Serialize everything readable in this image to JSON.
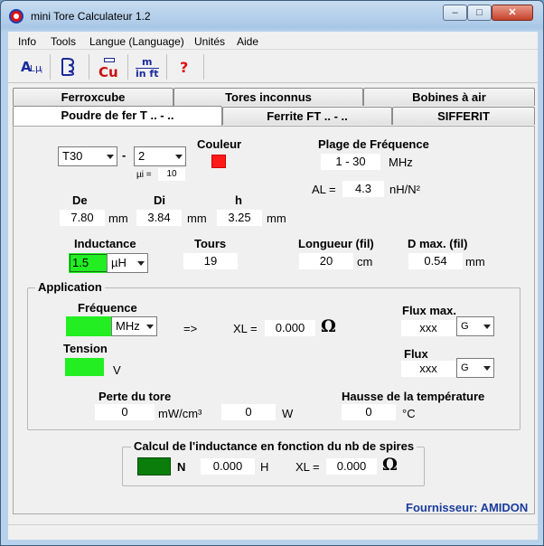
{
  "window": {
    "title": "mini Tore Calculateur 1.2",
    "min": "–",
    "max": "□",
    "close": "✕"
  },
  "menu": [
    "Info",
    "Tools",
    "Langue (Language)",
    "Unités",
    "Aide"
  ],
  "toolbar": [
    {
      "icon": "al-mu-icon",
      "text": "AL μi"
    },
    {
      "icon": "coil-icon",
      "text": "⌇"
    },
    {
      "icon": "copper-icon",
      "text": "Cu"
    },
    {
      "icon": "m-inft-icon",
      "text": "m in ft"
    },
    {
      "icon": "help-icon",
      "text": "?"
    }
  ],
  "tabs": {
    "row1": [
      "Ferroxcube",
      "Tores inconnus",
      "Bobines à air"
    ],
    "row2": [
      "Poudre de fer T .. - ..",
      "Ferrite FT .. - ..",
      "SIFFERIT"
    ]
  },
  "core": {
    "size": "T30",
    "dash": "-",
    "material": "2",
    "mu_label": "µi =",
    "mu_value": "10",
    "color_label": "Couleur",
    "color_hex": "#ff1a1a"
  },
  "freq_range": {
    "label": "Plage de Fréquence",
    "value": "1 - 30",
    "unit": "MHz"
  },
  "al": {
    "label": "AL =",
    "value": "4.3",
    "unit": "nH/N²"
  },
  "dims": {
    "de_label": "De",
    "de_value": "7.80",
    "de_unit": "mm",
    "di_label": "Di",
    "di_value": "3.84",
    "di_unit": "mm",
    "h_label": "h",
    "h_value": "3.25",
    "h_unit": "mm"
  },
  "inductance": {
    "label": "Inductance",
    "value": "1.5",
    "unit": "µH"
  },
  "turns": {
    "label": "Tours",
    "value": "19"
  },
  "length": {
    "label": "Longueur (fil)",
    "value": "20",
    "unit": "cm"
  },
  "dmax": {
    "label": "D max. (fil)",
    "value": "0.54",
    "unit": "mm"
  },
  "application": {
    "title": "Application",
    "freq_label": "Fréquence",
    "freq_unit": "MHz",
    "arrow": "=>",
    "xl_label": "XL =",
    "xl_value": "0.000",
    "omega": "Ω",
    "voltage_label": "Tension",
    "voltage_unit": "V",
    "flux_max_label": "Flux max.",
    "flux_max_value": "xxx",
    "flux_max_unit": "G",
    "flux_label": "Flux",
    "flux_value": "xxx",
    "flux_unit": "G",
    "loss_label": "Perte du tore",
    "loss_value": "0",
    "loss_unit": "mW/cm³",
    "loss_w_value": "0",
    "loss_w_unit": "W",
    "temp_label": "Hausse de la température",
    "temp_value": "0",
    "temp_unit": "°C"
  },
  "calc": {
    "title": "Calcul de l'inductance en fonction du nb de spires",
    "n_label": "N",
    "h_value": "0.000",
    "h_unit": "H",
    "xl_label": "XL =",
    "xl_value": "0.000",
    "omega": "Ω"
  },
  "supplier": "Fournisseur: AMIDON",
  "colors": {
    "green": "#22ee22",
    "dark_green": "#0b7d0b",
    "supplier_blue": "#1a3c9c"
  }
}
